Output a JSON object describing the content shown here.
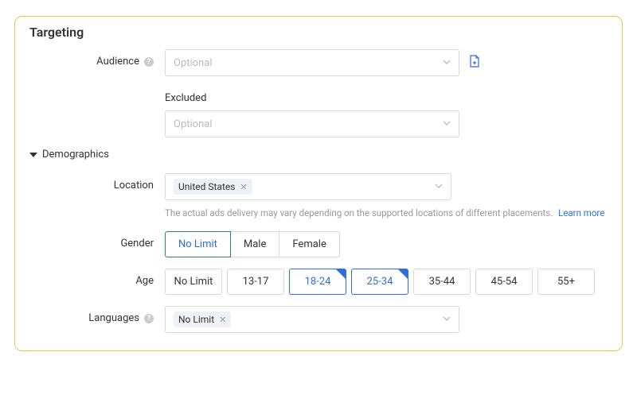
{
  "panel": {
    "title": "Targeting"
  },
  "audience": {
    "label": "Audience",
    "placeholder": "Optional",
    "excluded_label": "Excluded",
    "excluded_placeholder": "Optional"
  },
  "demographics": {
    "label": "Demographics"
  },
  "location": {
    "label": "Location",
    "tag": "United States",
    "note": "The actual ads delivery may vary depending on the supported locations of different placements.",
    "learn_more": "Learn more"
  },
  "gender": {
    "label": "Gender",
    "options": [
      "No Limit",
      "Male",
      "Female"
    ],
    "selected": "No Limit"
  },
  "age": {
    "label": "Age",
    "options": [
      "No Limit",
      "13-17",
      "18-24",
      "25-34",
      "35-44",
      "45-54",
      "55+"
    ],
    "selected": [
      "18-24",
      "25-34"
    ]
  },
  "languages": {
    "label": "Languages",
    "tag": "No Limit"
  }
}
